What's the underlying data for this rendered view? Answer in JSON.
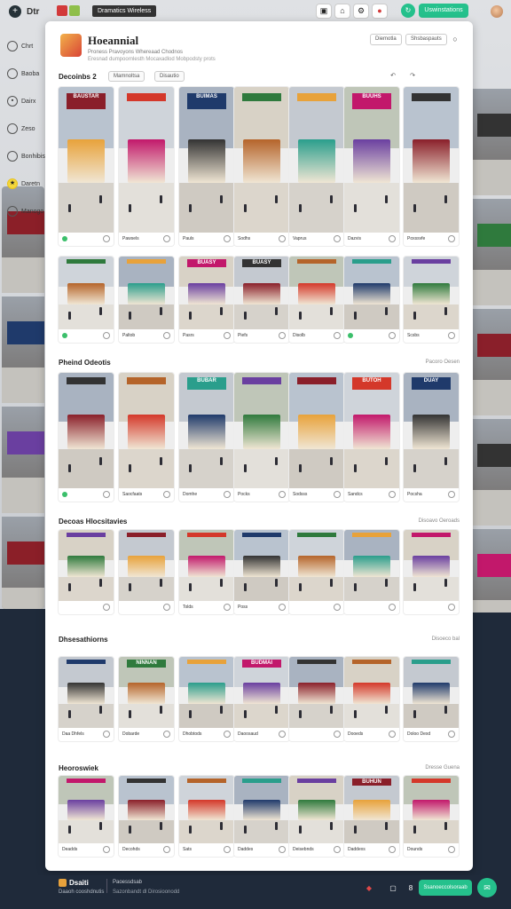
{
  "topbar": {
    "app_name": "Dtr",
    "window_title": "Dramatics Wireless",
    "cta_label": "Uswinstations",
    "logo_icon": "plus-icon",
    "icons": [
      "camera-icon",
      "home-icon",
      "settings-icon",
      "record-icon"
    ]
  },
  "sidebar": {
    "items": [
      {
        "label": "Chrt",
        "icon": "circle-icon"
      },
      {
        "label": "Baoba",
        "icon": "circle-icon"
      },
      {
        "label": "Dairx",
        "icon": "grid-icon"
      },
      {
        "label": "Zeso",
        "icon": "circle-icon"
      },
      {
        "label": "Bonhibisu",
        "icon": "circle-icon"
      },
      {
        "label": "Daretn",
        "icon": "star-icon"
      },
      {
        "label": "Manogo",
        "icon": "circle-icon"
      }
    ]
  },
  "panel": {
    "title": "Hoeannial",
    "subtitle": "Proness Pravoyons Whereaad Chodnos",
    "subtitle2": "Eresnad dumpoornlesth Mocaxadlod Mobpodsty prots",
    "header_btn1": "Diemotla",
    "header_btn2": "Shsbaspauts"
  },
  "sections": [
    {
      "label": "Decoinbs 2",
      "more": "",
      "filters": [
        "Mamnoltsa",
        "Disautio"
      ]
    },
    {
      "label": "Pheind Odeotis",
      "more": "Pacoro Oesen"
    },
    {
      "label": "Decoas Hlocsitavies",
      "more": "Disoavo Oeroads"
    },
    {
      "label": "Dhsesathiorns",
      "more": "Disoeco bal"
    },
    {
      "label": "Heoroswiek",
      "more": "Dresse Guena"
    }
  ],
  "cards": {
    "row1": [
      {
        "sign": "BAUSTAR",
        "label": "",
        "status": "#3bbf6b"
      },
      {
        "sign": "",
        "label": "Pawsels",
        "status": ""
      },
      {
        "sign": "BUIMAS",
        "label": "Pauls",
        "status": ""
      },
      {
        "sign": "",
        "label": "Sodhs",
        "status": ""
      },
      {
        "sign": "",
        "label": "Vaprus",
        "status": ""
      },
      {
        "sign": "BUUHS",
        "label": "Dazvis",
        "status": ""
      },
      {
        "sign": "",
        "label": "Poxssvfe",
        "status": ""
      }
    ],
    "row2": [
      {
        "sign": "",
        "label": "",
        "status": "#3bbf6b"
      },
      {
        "sign": "",
        "label": "Paltob",
        "status": ""
      },
      {
        "sign": "BUASY",
        "label": "Pasrs",
        "status": ""
      },
      {
        "sign": "BUASY",
        "label": "Piefs",
        "status": ""
      },
      {
        "sign": "",
        "label": "Disolb",
        "status": ""
      },
      {
        "sign": "",
        "label": "",
        "status": "#3bbf6b"
      },
      {
        "sign": "",
        "label": "Scsbs",
        "status": ""
      }
    ],
    "row3": [
      {
        "sign": "",
        "label": "",
        "status": "#3bbf6b"
      },
      {
        "sign": "",
        "label": "Saocfaats",
        "status": ""
      },
      {
        "sign": "BUBAR",
        "label": "Domhe",
        "status": ""
      },
      {
        "sign": "",
        "label": "Pocks",
        "status": ""
      },
      {
        "sign": "",
        "label": "Sodsss",
        "status": ""
      },
      {
        "sign": "BUTOH",
        "label": "Sandcs",
        "status": ""
      },
      {
        "sign": "DUAY",
        "label": "Pocsha",
        "status": ""
      }
    ],
    "row4": [
      {
        "sign": "",
        "label": "",
        "status": ""
      },
      {
        "sign": "",
        "label": "",
        "status": ""
      },
      {
        "sign": "",
        "label": "Tolds",
        "status": ""
      },
      {
        "sign": "",
        "label": "Poss",
        "status": ""
      },
      {
        "sign": "",
        "label": "",
        "status": ""
      },
      {
        "sign": "",
        "label": "",
        "status": ""
      },
      {
        "sign": "",
        "label": "",
        "status": ""
      }
    ],
    "row5": [
      {
        "sign": "",
        "label": "Daa Dhfels",
        "status": ""
      },
      {
        "sign": "NINNAN",
        "label": "Dobarde",
        "status": ""
      },
      {
        "sign": "",
        "label": "Dhobtods",
        "status": ""
      },
      {
        "sign": "BUDMAI",
        "label": "Daoosaud",
        "status": ""
      },
      {
        "sign": "",
        "label": "",
        "status": ""
      },
      {
        "sign": "",
        "label": "Dooeds",
        "status": ""
      },
      {
        "sign": "",
        "label": "Doloo Dexd",
        "status": ""
      }
    ],
    "row6": [
      {
        "sign": "",
        "label": "Deadds",
        "status": ""
      },
      {
        "sign": "",
        "label": "Decohds",
        "status": ""
      },
      {
        "sign": "",
        "label": "Sats",
        "status": ""
      },
      {
        "sign": "",
        "label": "Daddes",
        "status": ""
      },
      {
        "sign": "",
        "label": "Deisebnds",
        "status": ""
      },
      {
        "sign": "BUHUN",
        "label": "Daddexs",
        "status": ""
      },
      {
        "sign": "",
        "label": "Dounds",
        "status": ""
      }
    ]
  },
  "bottombar": {
    "name": "Dsaiti",
    "sub": "Daaoh cooshdnutis",
    "label1": "Paoessdsab",
    "label2": "Sazonbandt dl Dirosioonodd",
    "cta_label": "Ssanoeccolsoraab"
  },
  "colors": {
    "accent": "#25c18c",
    "panel_bg": "#ffffff",
    "page_bg": "#1f2a3a",
    "sign_palette": [
      "#8a1f2a",
      "#d4382a",
      "#1f3a6b",
      "#2f7a3d",
      "#e8a23a",
      "#c2186b",
      "#333333",
      "#b5642a",
      "#2a9e8c",
      "#6a3fa0"
    ]
  }
}
